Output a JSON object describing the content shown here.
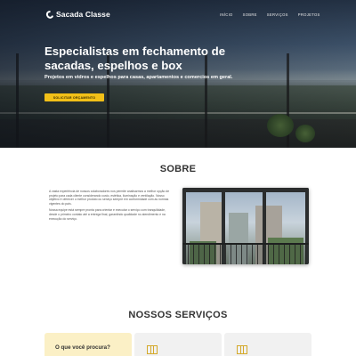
{
  "header": {
    "logo_text": "Sacada Classe",
    "nav": [
      {
        "label": "INÍCIO"
      },
      {
        "label": "SOBRE"
      },
      {
        "label": "SERVIÇOS"
      },
      {
        "label": "PROJETOS"
      }
    ]
  },
  "hero": {
    "title": "Especialistas em fechamento de sacadas, espelhos e box",
    "subtitle": "Projetos em vidros e espelhos para casas, apartamentos e comercios em geral.",
    "cta_label": "SOLICITAR ORÇAMENTO"
  },
  "sobre": {
    "title": "SOBRE",
    "paragraph1": "A vasta experiência de nossos colaboradores nos permite analisarmos a melhor opção de projeto para cada cliente considerando custo, estética, iluminação e ventilação. Nosso objetivo é oferecer o melhor produto ou serviço sempre em conformidade com as normas vigentes do país.",
    "paragraph2": "Nossa equipe está sempre pronta para orientar e executar o serviço com tranquilidade, desde o primeiro contato até a entrega final, garantindo qualidade no atendimento e na execução do serviço."
  },
  "servicos": {
    "title": "NOSSOS SERVIÇOS",
    "card1_text": "O que você procura?"
  },
  "colors": {
    "accent": "#f2c018",
    "card_yellow": "#fbf0c6",
    "card_grey": "#f1f1f1"
  }
}
